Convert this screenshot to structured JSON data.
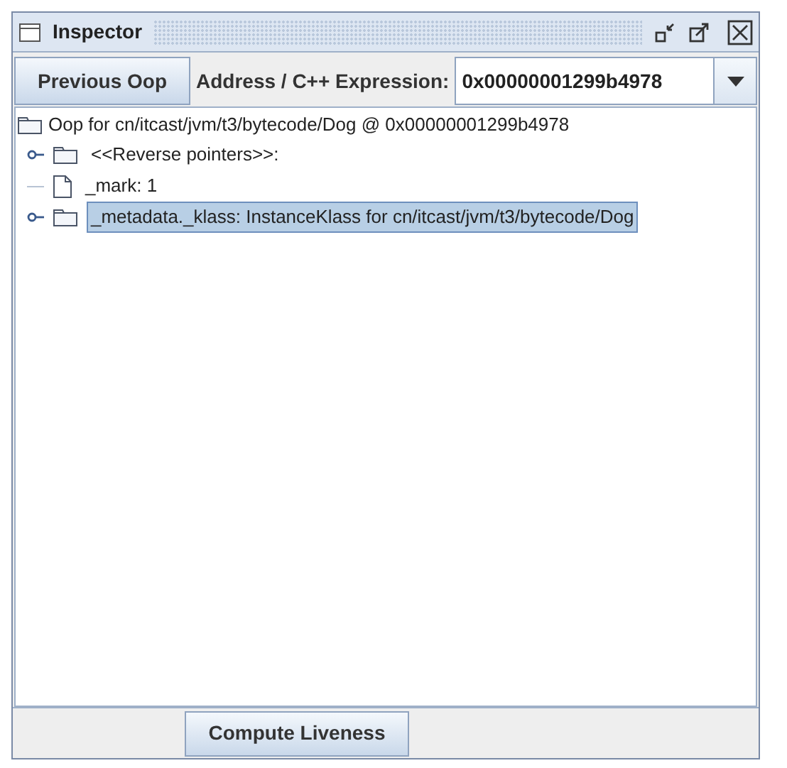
{
  "window": {
    "title": "Inspector"
  },
  "toolbar": {
    "previous_button": "Previous Oop",
    "address_label": "Address / C++ Expression:",
    "address_value": "0x00000001299b4978"
  },
  "tree": {
    "root": {
      "label": "Oop for cn/itcast/jvm/t3/bytecode/Dog @ 0x00000001299b4978",
      "children": [
        {
          "kind": "folder",
          "label": "<<Reverse pointers>>:",
          "selected": false
        },
        {
          "kind": "leaf",
          "label": "_mark: 1",
          "selected": false
        },
        {
          "kind": "folder",
          "label": "_metadata._klass: InstanceKlass for cn/itcast/jvm/t3/bytecode/Dog",
          "selected": true
        }
      ]
    }
  },
  "bottom_button": "Compute Liveness"
}
